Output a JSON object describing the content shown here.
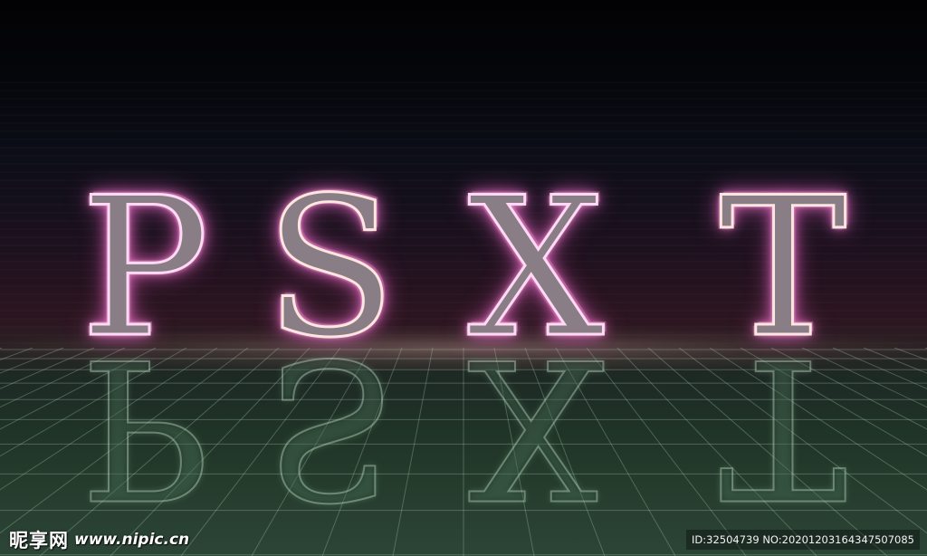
{
  "scene": {
    "letters": [
      "P",
      "S",
      "X",
      "T"
    ],
    "glow_color": "#ff9ad6",
    "stroke_color": "#ffdaf4",
    "reflection_color": "#c8e6cd",
    "sky_top_color": "#020204",
    "floor_color": "#2c4536"
  },
  "watermark": {
    "site_name": "昵享网",
    "site_url": "www.nipic.cn",
    "id_text": "ID:32504739 NO:20201203164347507085"
  }
}
